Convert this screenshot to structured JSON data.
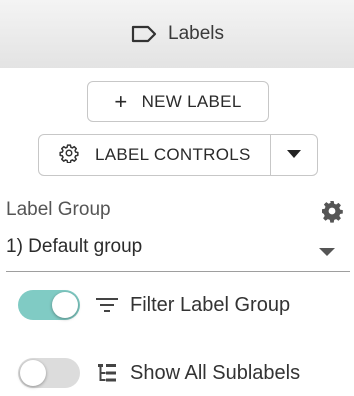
{
  "header": {
    "title": "Labels",
    "icon": "label-tag-icon"
  },
  "actions": {
    "new_label": "NEW LABEL",
    "label_controls": "LABEL CONTROLS"
  },
  "group": {
    "heading": "Label Group",
    "selected": "1) Default group"
  },
  "toggles": [
    {
      "label": "Filter Label Group",
      "on": true,
      "icon": "filter-icon"
    },
    {
      "label": "Show All Sublabels",
      "on": false,
      "icon": "hierarchy-icon"
    }
  ],
  "colors": {
    "toggle_on": "#80cbc4",
    "toggle_off": "#dcdcdc"
  }
}
